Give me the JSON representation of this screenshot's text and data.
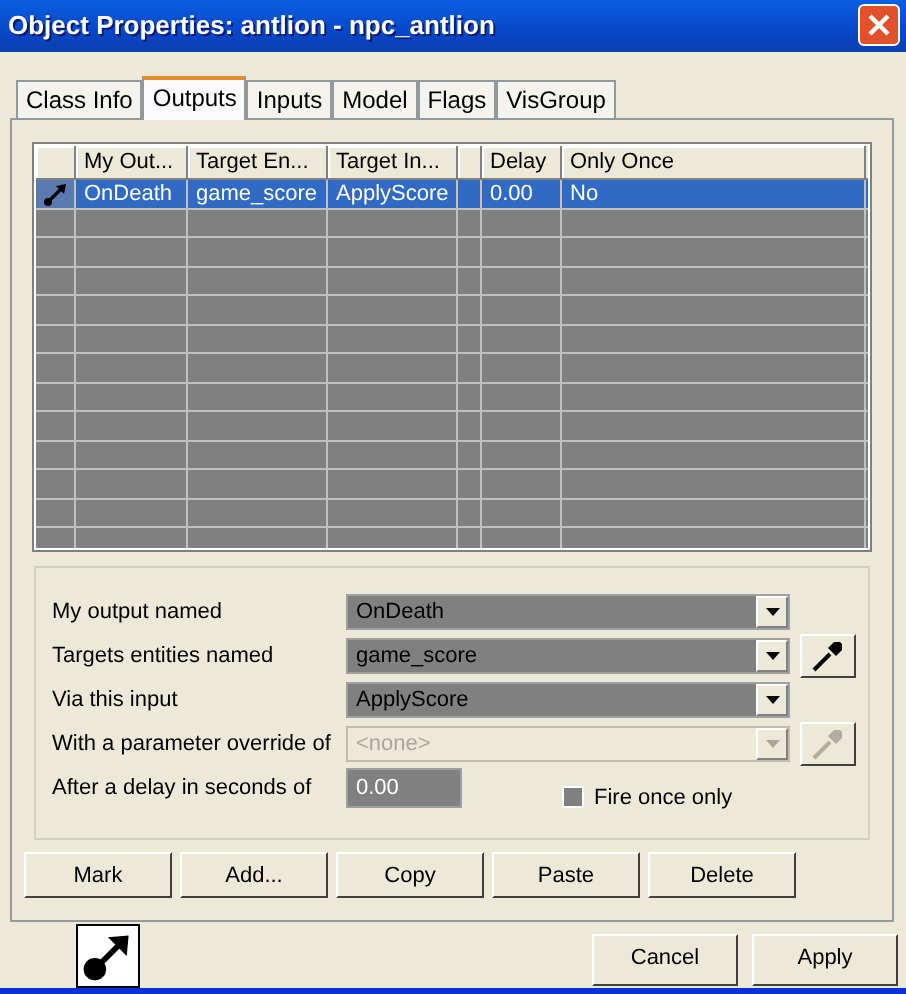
{
  "window": {
    "title": "Object Properties: antlion - npc_antlion"
  },
  "tabs": [
    {
      "label": "Class Info",
      "selected": false
    },
    {
      "label": "Outputs",
      "selected": true
    },
    {
      "label": "Inputs",
      "selected": false
    },
    {
      "label": "Model",
      "selected": false
    },
    {
      "label": "Flags",
      "selected": false
    },
    {
      "label": "VisGroup",
      "selected": false
    }
  ],
  "table": {
    "columns": [
      "My Out...",
      "Target En...",
      "Target In...",
      "Delay",
      "Only Once"
    ],
    "rows": [
      {
        "selected": true,
        "cells": [
          "OnDeath",
          "game_score",
          "ApplyScore",
          "0.00",
          "No"
        ]
      }
    ]
  },
  "form": {
    "fields": [
      {
        "kind": "combo",
        "label": "My output named",
        "value": "OnDeath",
        "disabled": false,
        "picker": false
      },
      {
        "kind": "combo",
        "label": "Targets entities named",
        "value": "game_score",
        "disabled": false,
        "picker": true
      },
      {
        "kind": "combo",
        "label": "Via this input",
        "value": "ApplyScore",
        "disabled": false,
        "picker": false
      },
      {
        "kind": "combo",
        "label": "With a parameter override of",
        "value": "<none>",
        "disabled": true,
        "picker": true
      },
      {
        "kind": "text",
        "label": "After a delay in seconds of",
        "value": "0.00",
        "disabled": false
      }
    ],
    "checkbox": {
      "label": "Fire once only",
      "checked": false
    }
  },
  "buttons": [
    "Mark",
    "Add...",
    "Copy",
    "Paste",
    "Delete"
  ],
  "dialog_buttons": [
    "Cancel",
    "Apply"
  ]
}
